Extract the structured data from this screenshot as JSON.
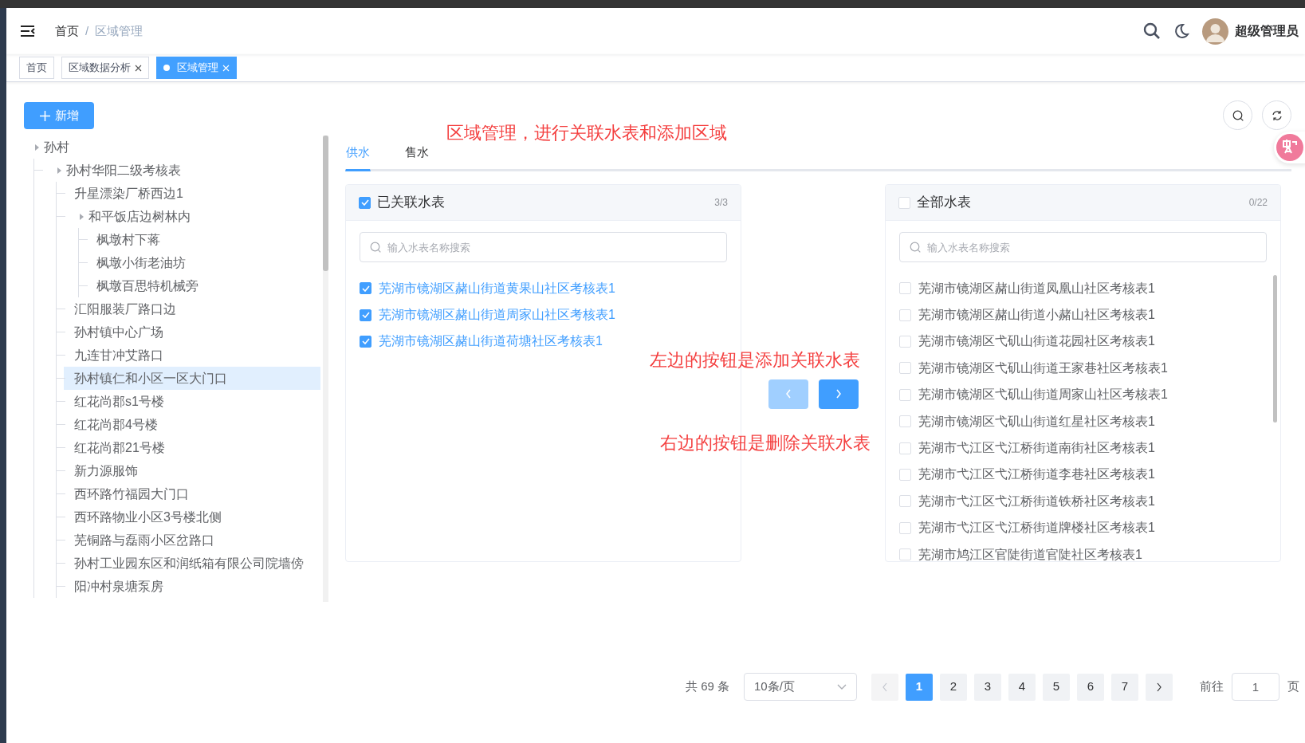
{
  "header": {
    "breadcrumb": [
      {
        "label": "首页",
        "current": false
      },
      {
        "label": "区域管理",
        "current": true
      }
    ],
    "separator": "/",
    "user": "超级管理员"
  },
  "page_tabs": [
    {
      "label": "首页",
      "closable": false,
      "selected": false
    },
    {
      "label": "区域数据分析",
      "closable": true,
      "selected": false
    },
    {
      "label": "区域管理",
      "closable": true,
      "selected": true
    }
  ],
  "add_button": "新增",
  "tree": [
    {
      "label": "孙村",
      "selected": false,
      "children": [
        {
          "label": "孙村华阳二级考核表",
          "selected": false,
          "children": [
            {
              "label": "升星漂染厂桥西边1",
              "selected": false
            },
            {
              "label": "和平饭店边树林内",
              "selected": false,
              "children": [
                {
                  "label": "枫墩村下蒋",
                  "selected": false
                },
                {
                  "label": "枫墩小街老油坊",
                  "selected": false
                },
                {
                  "label": "枫墩百思特机械旁",
                  "selected": false
                }
              ]
            },
            {
              "label": "汇阳服装厂路口边",
              "selected": false
            },
            {
              "label": "孙村镇中心广场",
              "selected": false
            },
            {
              "label": "九连甘冲艾路口",
              "selected": false
            },
            {
              "label": "孙村镇仁和小区一区大门口",
              "selected": true
            },
            {
              "label": "红花尚郡s1号楼",
              "selected": false
            },
            {
              "label": "红花尚郡4号楼",
              "selected": false
            },
            {
              "label": "红花尚郡21号楼",
              "selected": false
            },
            {
              "label": "新力源服饰",
              "selected": false
            },
            {
              "label": "西环路竹福园大门口",
              "selected": false
            },
            {
              "label": "西环路物业小区3号楼北侧",
              "selected": false
            },
            {
              "label": "芜铜路与磊雨小区岔路口",
              "selected": false
            },
            {
              "label": "孙村工业园东区和润纸箱有限公司院墙傍",
              "selected": false
            },
            {
              "label": "阳冲村泉塘泵房",
              "selected": false
            }
          ]
        }
      ]
    }
  ],
  "annotations": [
    "区域管理，进行关联水表和添加区域",
    "左边的按钮是添加关联水表",
    "右边的按钮是删除关联水表"
  ],
  "water_tabs": [
    {
      "label": "供水",
      "selected": true
    },
    {
      "label": "售水",
      "selected": false
    }
  ],
  "transfer": {
    "left": {
      "title": "已关联水表",
      "checked": true,
      "count": "3/3",
      "placeholder": "输入水表名称搜索",
      "items": [
        {
          "label": "芜湖市镜湖区赭山街道黄果山社区考核表1",
          "checked": true
        },
        {
          "label": "芜湖市镜湖区赭山街道周家山社区考核表1",
          "checked": true
        },
        {
          "label": "芜湖市镜湖区赭山街道荷塘社区考核表1",
          "checked": true
        }
      ]
    },
    "buttons": [
      {
        "kind": "left",
        "disabled": true
      },
      {
        "kind": "right",
        "disabled": false
      }
    ],
    "right": {
      "title": "全部水表",
      "checked": false,
      "count": "0/22",
      "placeholder": "输入水表名称搜索",
      "items": [
        {
          "label": "芜湖市镜湖区赭山街道凤凰山社区考核表1",
          "checked": false
        },
        {
          "label": "芜湖市镜湖区赭山街道小赭山社区考核表1",
          "checked": false
        },
        {
          "label": "芜湖市镜湖区弋矶山街道花园社区考核表1",
          "checked": false
        },
        {
          "label": "芜湖市镜湖区弋矶山街道王家巷社区考核表1",
          "checked": false
        },
        {
          "label": "芜湖市镜湖区弋矶山街道周家山社区考核表1",
          "checked": false
        },
        {
          "label": "芜湖市镜湖区弋矶山街道红星社区考核表1",
          "checked": false
        },
        {
          "label": "芜湖市弋江区弋江桥街道南街社区考核表1",
          "checked": false
        },
        {
          "label": "芜湖市弋江区弋江桥街道李巷社区考核表1",
          "checked": false
        },
        {
          "label": "芜湖市弋江区弋江桥街道铁桥社区考核表1",
          "checked": false
        },
        {
          "label": "芜湖市弋江区弋江桥街道牌楼社区考核表1",
          "checked": false
        },
        {
          "label": "芜湖市鸠江区官陡街道官陡社区考核表1",
          "checked": false
        }
      ]
    }
  },
  "pagination": {
    "total": "共 69 条",
    "page_size": "10条/页",
    "prev_disabled": true,
    "pages": [
      {
        "label": "1",
        "selected": true
      },
      {
        "label": "2",
        "selected": false
      },
      {
        "label": "3",
        "selected": false
      },
      {
        "label": "4",
        "selected": false
      },
      {
        "label": "5",
        "selected": false
      },
      {
        "label": "6",
        "selected": false
      },
      {
        "label": "7",
        "selected": false
      }
    ],
    "goto_label": "前往",
    "goto_value": "1",
    "page_suffix": "页"
  }
}
